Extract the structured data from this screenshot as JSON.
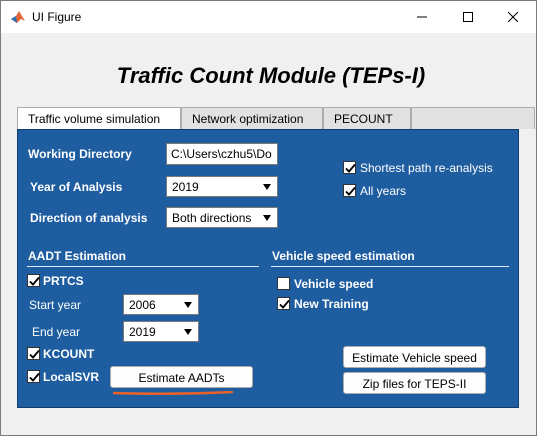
{
  "window": {
    "title": "UI Figure"
  },
  "module_title": "Traffic Count Module (TEPs-I)",
  "tabs": [
    {
      "label": "Traffic volume simulation",
      "active": true
    },
    {
      "label": "Network optimization",
      "active": false
    },
    {
      "label": "PECOUNT",
      "active": false
    }
  ],
  "settings": {
    "working_dir_label": "Working Directory",
    "working_dir_value": "C:\\Users\\czhu5\\Do",
    "year_label": "Year of Analysis",
    "year_value": "2019",
    "direction_label": "Direction of analysis",
    "direction_value": "Both directions",
    "shortest_path": {
      "label": "Shortest path re-analysis",
      "checked": true
    },
    "all_years": {
      "label": "All years",
      "checked": true
    }
  },
  "aadt": {
    "heading": "AADT Estimation",
    "prtcs": {
      "label": "PRTCS",
      "checked": true
    },
    "start_year_label": "Start year",
    "start_year_value": "2006",
    "end_year_label": "End year",
    "end_year_value": "2019",
    "kcount": {
      "label": "KCOUNT",
      "checked": true
    },
    "localsvr": {
      "label": "LocalSVR",
      "checked": true
    },
    "estimate_button": "Estimate AADTs"
  },
  "speed": {
    "heading": "Vehicle speed estimation",
    "vehicle_speed": {
      "label": "Vehicle speed",
      "checked": false
    },
    "new_training": {
      "label": "New Training",
      "checked": true
    },
    "estimate_button": "Estimate Vehicle speed",
    "zip_button": "Zip files for TEPS-II"
  },
  "colors": {
    "panel": "#1e5da0",
    "annotation_underline": "#e8622a"
  }
}
